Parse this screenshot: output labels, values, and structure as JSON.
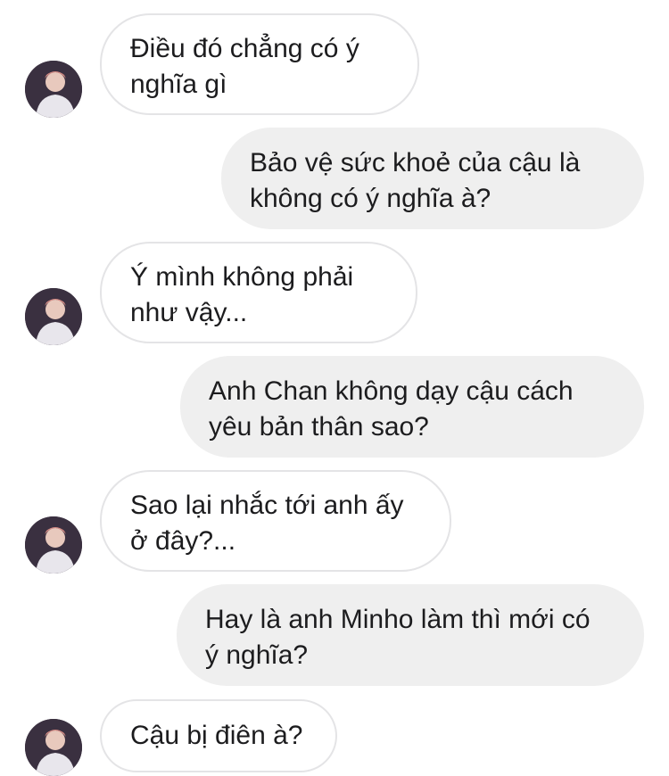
{
  "conversation": {
    "messages": [
      {
        "side": "incoming",
        "text": "Điều đó chẳng có ý\nnghĩa gì"
      },
      {
        "side": "outgoing",
        "text": "Bảo vệ sức khoẻ của cậu là\nkhông có ý nghĩa à?"
      },
      {
        "side": "incoming",
        "text": " Ý mình không phải\nnhư vậy..."
      },
      {
        "side": "outgoing",
        "text": "Anh Chan không dạy cậu cách\nyêu bản thân sao?"
      },
      {
        "side": "incoming",
        "text": "Sao lại nhắc tới anh ấy\nở đây?..."
      },
      {
        "side": "outgoing",
        "text": "Hay là anh Minho làm thì mới có\ný nghĩa?"
      },
      {
        "side": "incoming",
        "text": "Cậu bị điên à?"
      }
    ]
  },
  "colors": {
    "incoming_bg": "#ffffff",
    "incoming_border": "#e4e4e6",
    "outgoing_bg": "#efefef",
    "text": "#1c1c1e"
  },
  "icons": {
    "avatar": "contact-avatar-photo"
  }
}
